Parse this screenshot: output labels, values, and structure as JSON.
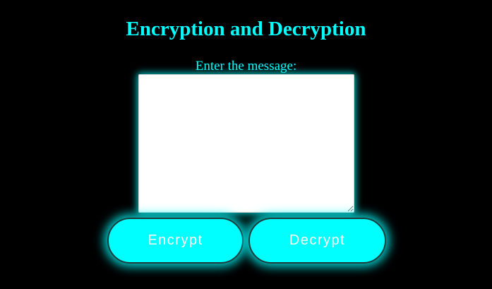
{
  "page": {
    "title": "Encryption and Decryption",
    "message_label": "Enter the message:"
  },
  "message_input": {
    "value": "",
    "placeholder": ""
  },
  "buttons": {
    "encrypt_label": "Encrypt",
    "decrypt_label": "Decrypt"
  },
  "colors": {
    "background": "#000000",
    "accent": "#00ffff",
    "button_text": "#ffffff",
    "textarea_bg": "#ffffff"
  }
}
